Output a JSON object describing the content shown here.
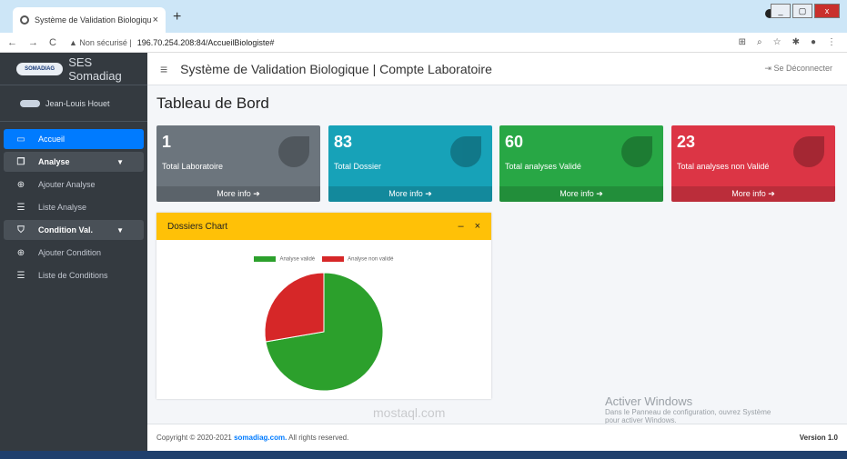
{
  "browser": {
    "tab_title": "Système de Validation Biologiqu",
    "tab_close": "×",
    "new_tab": "+",
    "security": "Non sécurisé",
    "url": "196.70.254.208:84/AccueilBiologiste#"
  },
  "sidebar": {
    "brand": "SES Somadiag",
    "logo_text": "SOMADIAG",
    "user": "Jean-Louis Houet",
    "items": [
      {
        "label": "Accueil"
      },
      {
        "label": "Analyse"
      },
      {
        "label": "Ajouter Analyse"
      },
      {
        "label": "Liste Analyse"
      },
      {
        "label": "Condition Val."
      },
      {
        "label": "Ajouter Condition"
      },
      {
        "label": "Liste de Conditions"
      }
    ]
  },
  "header": {
    "title": "Système de Validation Biologique | Compte Laboratoire",
    "logout": "Se Déconnecter"
  },
  "page": {
    "title": "Tableau de Bord"
  },
  "stats": [
    {
      "value": "1",
      "label": "Total Laboratoire",
      "more": "More info ➔"
    },
    {
      "value": "83",
      "label": "Total Dossier",
      "more": "More info ➔"
    },
    {
      "value": "60",
      "label": "Total analyses Validé",
      "more": "More info ➔"
    },
    {
      "value": "23",
      "label": "Total analyses non Validé",
      "more": "More info ➔"
    }
  ],
  "card": {
    "title": "Dossiers Chart",
    "minimize": "–",
    "close": "×"
  },
  "chart_data": {
    "type": "pie",
    "categories": [
      "Analyse validé",
      "Analyse non validé"
    ],
    "values": [
      60,
      23
    ],
    "colors": [
      "#2ca02c",
      "#d62728"
    ],
    "legend": "top"
  },
  "footer": {
    "copyright": "Copyright © 2020-2021",
    "site": "somadiag.com.",
    "rights": "All rights reserved.",
    "version": "Version 1.0"
  },
  "windows_watermark": {
    "line1": "Activer Windows",
    "line2": "Dans le Panneau de configuration, ouvrez Système",
    "line3": "pour activer Windows."
  },
  "watermark": "mostaql.com"
}
